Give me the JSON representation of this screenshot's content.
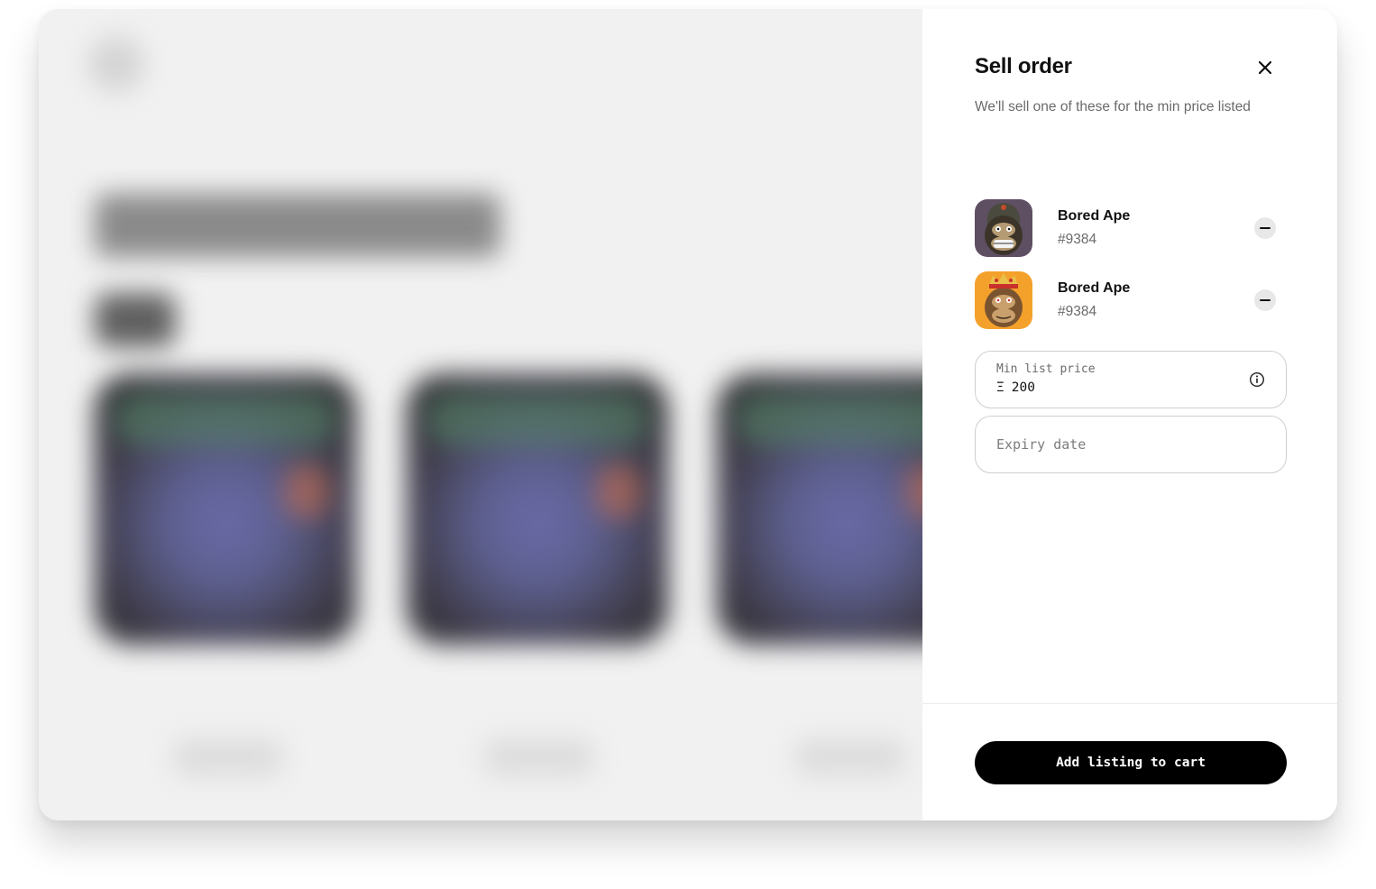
{
  "sell_order": {
    "title": "Sell order",
    "subtitle": "We'll sell one of these for the min price listed",
    "items": [
      {
        "name": "Bored Ape",
        "token_id": "#9384",
        "thumb_bg": "#5f4f63",
        "fur_color": "#5a4d3c"
      },
      {
        "name": "Bored Ape",
        "token_id": "#9384",
        "thumb_bg": "#f4a12c",
        "fur_color": "#a87a45"
      }
    ],
    "min_price": {
      "label": "Min list price",
      "currency": "Ξ",
      "value": "200"
    },
    "expiry": {
      "placeholder": "Expiry date"
    },
    "add_button": "Add listing to cart"
  },
  "icons": {
    "close": "close-icon",
    "remove": "minus-icon",
    "info": "info-icon"
  },
  "colors": {
    "accent": "#000000",
    "muted_text": "#6b6b6b",
    "border": "#cfcfcf"
  }
}
